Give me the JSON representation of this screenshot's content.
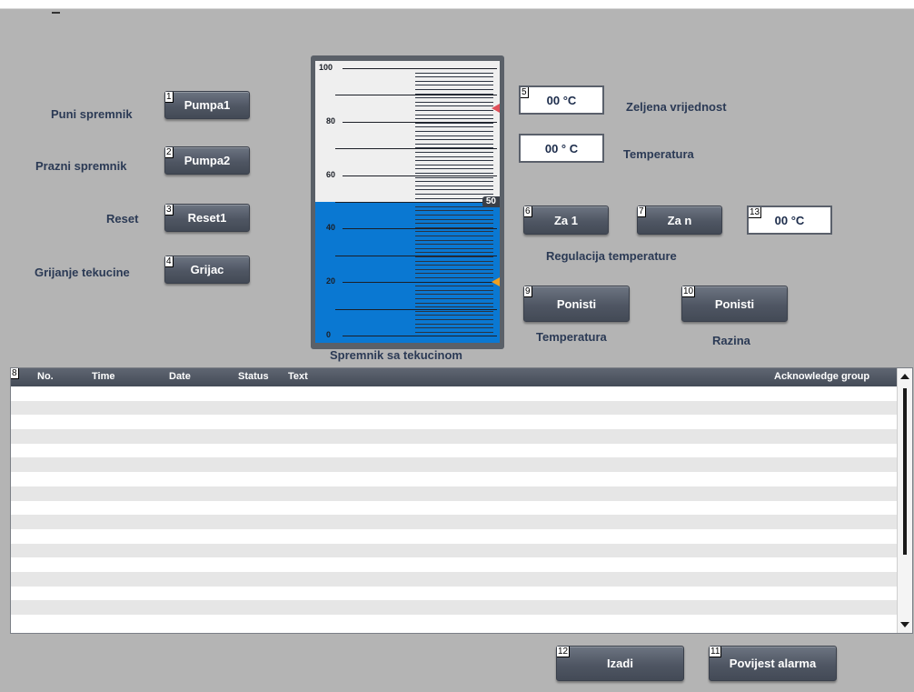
{
  "labels": {
    "puni_spremnik": "Puni spremnik",
    "prazni_spremnik": "Prazni spremnik",
    "reset": "Reset",
    "grijanje": "Grijanje tekucine",
    "zeljena": "Zeljena vrijednost",
    "temperatura": "Temperatura",
    "regulacija": "Regulacija temperature",
    "temperatura2": "Temperatura",
    "razina": "Razina",
    "spremnik": "Spremnik sa tekucinom"
  },
  "buttons": {
    "pumpa1": {
      "num": "1",
      "label": "Pumpa1"
    },
    "pumpa2": {
      "num": "2",
      "label": "Pumpa2"
    },
    "reset1": {
      "num": "3",
      "label": "Reset1"
    },
    "grijac": {
      "num": "4",
      "label": "Grijac"
    },
    "za1": {
      "num": "6",
      "label": "Za 1"
    },
    "zan": {
      "num": "7",
      "label": "Za n"
    },
    "ponisti_temp": {
      "num": "9",
      "label": "Ponisti"
    },
    "ponisti_razina": {
      "num": "10",
      "label": "Ponisti"
    },
    "izadi": {
      "num": "12",
      "label": "Izadi"
    },
    "povijest": {
      "num": "11",
      "label": "Povijest alarma"
    }
  },
  "fields": {
    "zeljena": {
      "num": "5",
      "value": "00 °C"
    },
    "temperatura": {
      "value": "00 ° C"
    },
    "field13": {
      "num": "13",
      "value": "00 °C"
    }
  },
  "tank": {
    "scale": [
      "100",
      "80",
      "60",
      "40",
      "20",
      "0"
    ],
    "level_percent": 50,
    "level_label": "50",
    "setpoint_high_percent": 85,
    "setpoint_low_percent": 20,
    "fill_color": "#0a78d2",
    "marker_high_color": "#e0505a",
    "marker_low_color": "#f0a020"
  },
  "alarm_view": {
    "num": "8",
    "columns": [
      "No.",
      "Time",
      "Date",
      "Status",
      "Text",
      "Acknowledge group"
    ],
    "row_count": 17
  }
}
